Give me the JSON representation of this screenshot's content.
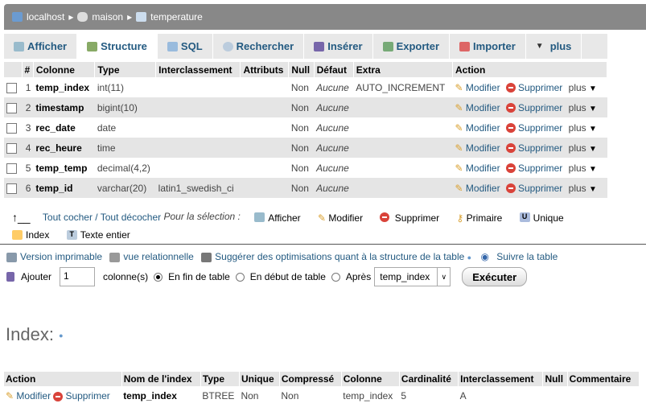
{
  "breadcrumb": [
    "localhost",
    "maison",
    "temperature"
  ],
  "tabs": [
    {
      "label": "Afficher"
    },
    {
      "label": "Structure",
      "active": true
    },
    {
      "label": "SQL"
    },
    {
      "label": "Rechercher"
    },
    {
      "label": "Insérer"
    },
    {
      "label": "Exporter"
    },
    {
      "label": "Importer"
    },
    {
      "label": "plus"
    }
  ],
  "structure": {
    "headers": [
      "#",
      "Colonne",
      "Type",
      "Interclassement",
      "Attributs",
      "Null",
      "Défaut",
      "Extra",
      "Action"
    ],
    "rows": [
      [
        "1",
        "temp_index",
        "int(11)",
        "",
        "",
        "Non",
        "Aucune",
        "AUTO_INCREMENT"
      ],
      [
        "2",
        "timestamp",
        "bigint(10)",
        "",
        "",
        "Non",
        "Aucune",
        ""
      ],
      [
        "3",
        "rec_date",
        "date",
        "",
        "",
        "Non",
        "Aucune",
        ""
      ],
      [
        "4",
        "rec_heure",
        "time",
        "",
        "",
        "Non",
        "Aucune",
        ""
      ],
      [
        "5",
        "temp_temp",
        "decimal(4,2)",
        "",
        "",
        "Non",
        "Aucune",
        ""
      ],
      [
        "6",
        "temp_id",
        "varchar(20)",
        "latin1_swedish_ci",
        "",
        "Non",
        "Aucune",
        ""
      ]
    ],
    "actions": {
      "modify": "Modifier",
      "delete": "Supprimer",
      "more": "plus"
    }
  },
  "selection": {
    "check_all": "Tout cocher / Tout décocher",
    "for_selection": "Pour la sélection :",
    "actions": [
      "Afficher",
      "Modifier",
      "Supprimer",
      "Primaire",
      "Unique",
      "Index",
      "Texte entier"
    ]
  },
  "options": [
    "Version imprimable",
    "vue relationnelle",
    "Suggérer des optimisations quant à la structure de la table",
    "Suivre la table"
  ],
  "add": {
    "label": "Ajouter",
    "count": "1",
    "suffix": "colonne(s)",
    "pos_end": "En fin de table",
    "pos_start": "En début de table",
    "pos_after": "Après",
    "after_value": "temp_index",
    "submit": "Exécuter"
  },
  "index": {
    "title": "Index:",
    "headers": [
      "Action",
      "Nom de l'index",
      "Type",
      "Unique",
      "Compressé",
      "Colonne",
      "Cardinalité",
      "Interclassement",
      "Null",
      "Commentaire"
    ],
    "rows": [
      {
        "modify": "Modifier",
        "delete": "Supprimer",
        "name": "temp_index",
        "type": "BTREE",
        "unique": "Non",
        "packed": "Non",
        "column": "temp_index",
        "cardinality": "5",
        "collation": "A",
        "null": "",
        "comment": ""
      }
    ]
  }
}
